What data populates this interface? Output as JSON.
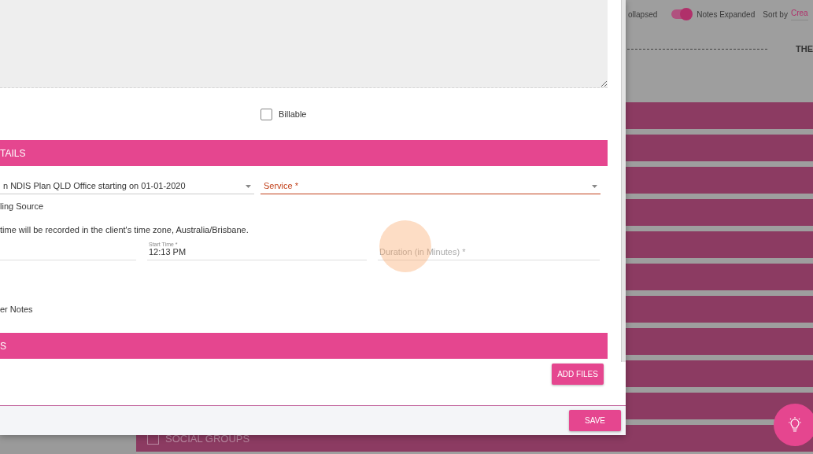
{
  "background": {
    "toolbar": {
      "collapsed_label": "ollapsed",
      "toggle": {
        "label": "Notes Expanded",
        "on": true
      },
      "sort_label": "Sort by",
      "sort_value": "Crea"
    },
    "heading": "THE",
    "group_row": {
      "label": "SOCIAL GROUPS",
      "checked": false
    }
  },
  "modal": {
    "billable": {
      "label": "Billable",
      "checked": false
    },
    "details_header": "TAILS",
    "plan_select": {
      "value": "n NDIS Plan QLD Office starting on 01-01-2020"
    },
    "service_select": {
      "placeholder": "Service *"
    },
    "funding_label": "ling Source",
    "timezone_note": "time will be recorded in the client's time zone, Australia/Brisbane.",
    "start_time": {
      "label": "Start Time *",
      "value": "12:13 PM"
    },
    "duration": {
      "placeholder": "Duration (in Minutes) *"
    },
    "other_notes_label": "er Notes",
    "files_header": "S",
    "add_files_button": "ADD FILES",
    "save_button": "SAVE"
  }
}
